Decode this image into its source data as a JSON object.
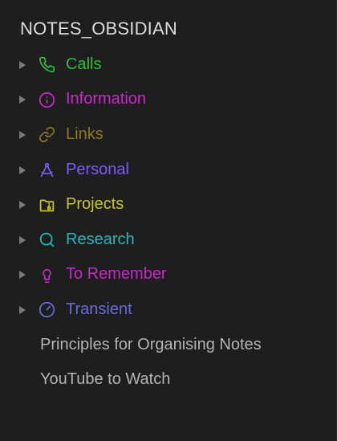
{
  "vault": {
    "title": "NOTES_OBSIDIAN"
  },
  "folders": [
    {
      "label": "Calls",
      "icon": "phone-icon",
      "color": "#2ebf3a"
    },
    {
      "label": "Information",
      "icon": "info-icon",
      "color": "#c92ac9"
    },
    {
      "label": "Links",
      "icon": "link-icon",
      "color": "#8c7a1e"
    },
    {
      "label": "Personal",
      "icon": "compass-drafting-icon",
      "color": "#7b5cf0"
    },
    {
      "label": "Projects",
      "icon": "folder-archive-icon",
      "color": "#c6c62a"
    },
    {
      "label": "Research",
      "icon": "search-icon",
      "color": "#22b8b8"
    },
    {
      "label": "To Remember",
      "icon": "lightbulb-icon",
      "color": "#c22bc2"
    },
    {
      "label": "Transient",
      "icon": "gauge-icon",
      "color": "#6b6bd6"
    }
  ],
  "files": [
    {
      "label": "Principles for Organising Notes"
    },
    {
      "label": "YouTube to Watch"
    }
  ]
}
